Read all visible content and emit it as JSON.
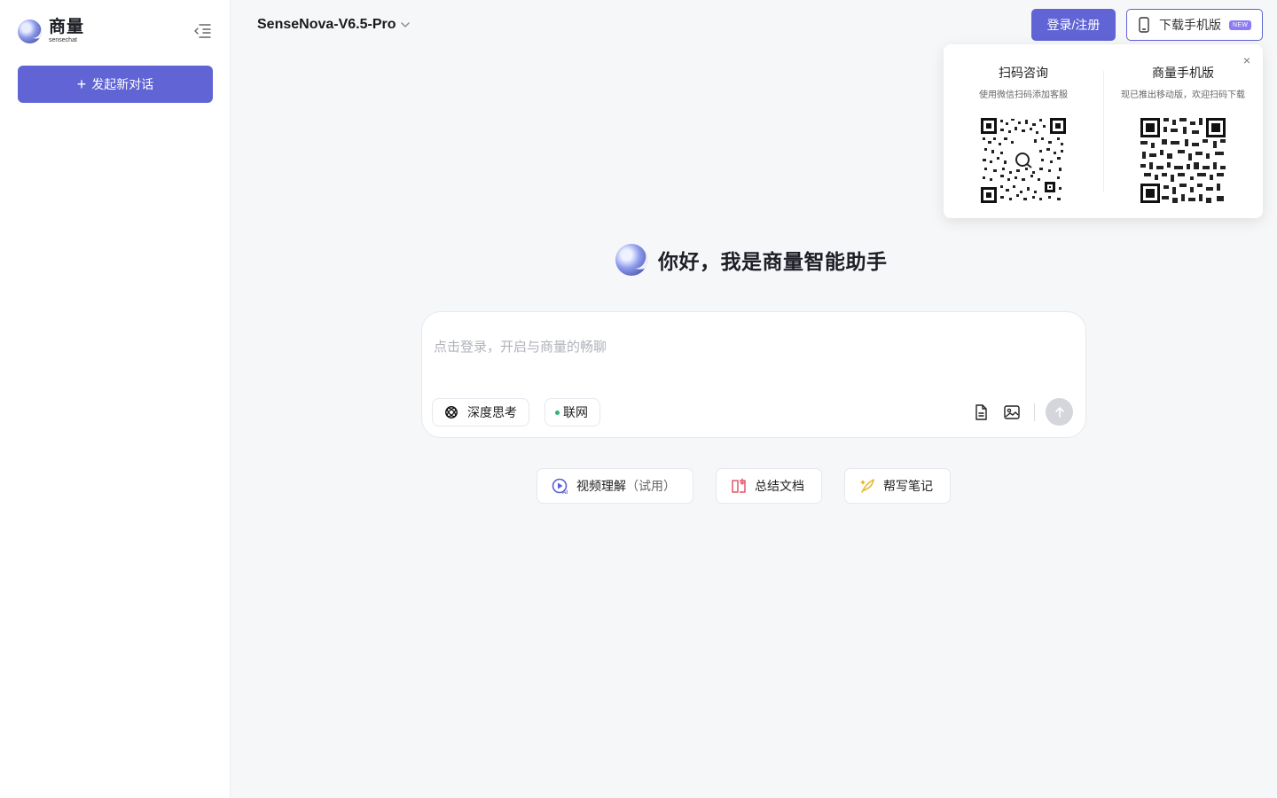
{
  "sidebar": {
    "brand_name": "商量",
    "brand_sub": "sensechat",
    "new_chat_label": "发起新对话",
    "collapse_icon": "menu-collapse-icon"
  },
  "header": {
    "model_name": "SenseNova-V6.5-Pro",
    "login_label": "登录/注册",
    "download_label": "下载手机版",
    "download_badge": "NEW"
  },
  "qr_popup": {
    "left_title": "扫码咨询",
    "left_desc": "使用微信扫码添加客服",
    "right_title": "商量手机版",
    "right_desc": "现已推出移动版，欢迎扫码下载"
  },
  "main": {
    "greeting": "你好，我是商量智能助手",
    "input_placeholder": "点击登录，开启与商量的畅聊",
    "deep_think_label": "深度思考",
    "web_label": "联网"
  },
  "suggestions": [
    {
      "label": "视频理解",
      "suffix": "（试用）"
    },
    {
      "label": "总结文档"
    },
    {
      "label": "帮写笔记"
    }
  ],
  "colors": {
    "accent": "#6064d4",
    "online_dot": "#2ab570",
    "badge": "#8b7cf3"
  }
}
